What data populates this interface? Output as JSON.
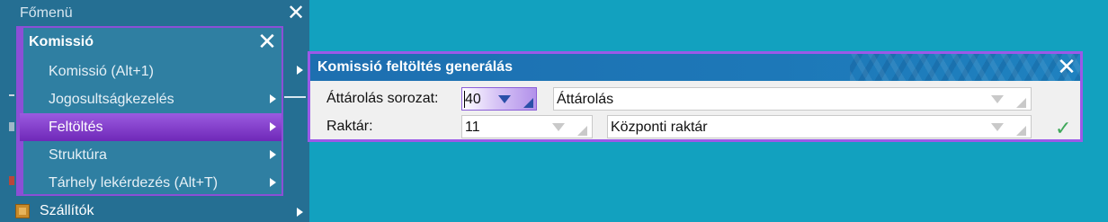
{
  "main_menu": {
    "title": "Főmenü",
    "bottom_item": {
      "label": "Szállítók",
      "icon": "box-icon"
    }
  },
  "submenu": {
    "title": "Komissió",
    "items": [
      {
        "label": "Komissió (Alt+1)"
      },
      {
        "label": "Jogosultságkezelés"
      },
      {
        "label": "Feltöltés",
        "active": true
      },
      {
        "label": "Struktúra"
      },
      {
        "label": "Tárhely lekérdezés (Alt+T)"
      }
    ]
  },
  "dialog": {
    "title": "Komissió feltöltés generálás",
    "fields": {
      "sorozat": {
        "label": "Áttárolás sorozat:",
        "code": "40",
        "name": "Áttárolás"
      },
      "raktar": {
        "label": "Raktár:",
        "code": "11",
        "name": "Központi raktár"
      }
    },
    "ok_icon": "check-icon"
  },
  "colors": {
    "background": "#12a1bf",
    "menu": "#256f93",
    "accent": "#9b59e8",
    "titlebar": "#1d6fb0"
  }
}
